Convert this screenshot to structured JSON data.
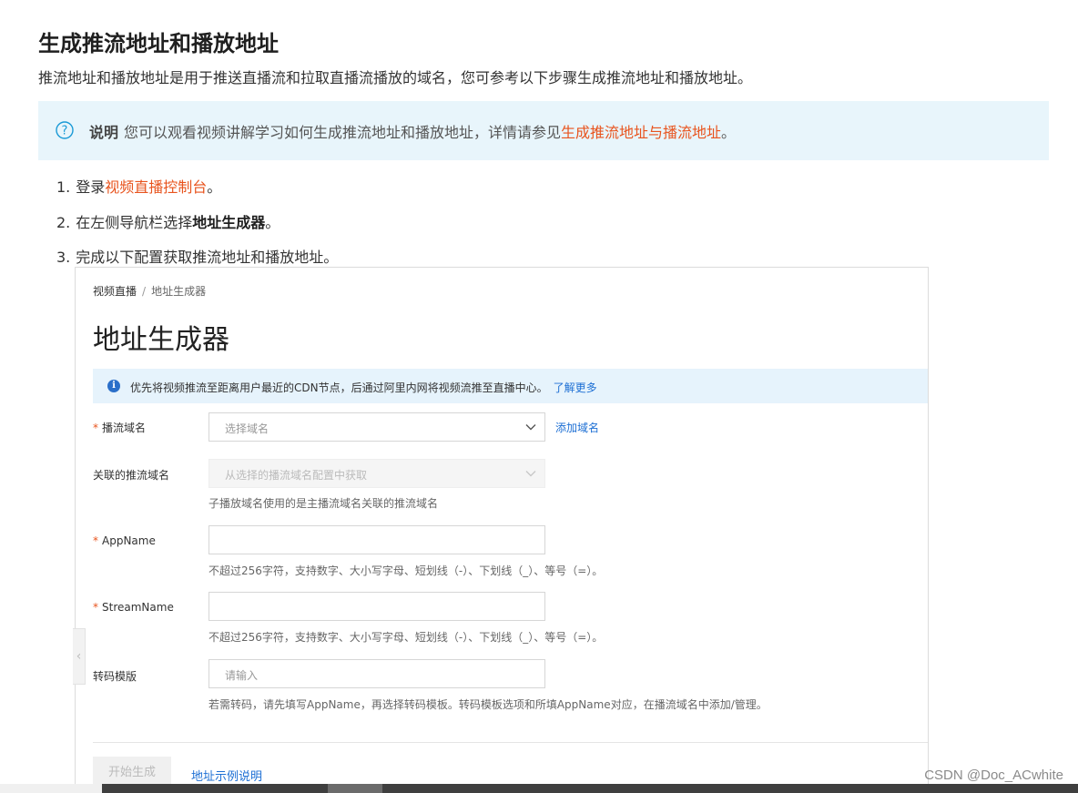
{
  "doc": {
    "title": "生成推流地址和播放地址",
    "intro": "推流地址和播放地址是用于推送直播流和拉取直播流播放的域名，您可参考以下步骤生成推流地址和播放地址。",
    "note": {
      "icon": "question-circle-icon",
      "label": "说明",
      "text": "您可以观看视频讲解学习如何生成推流地址和播放地址，详情请参见",
      "link": "生成推流地址与播流地址",
      "end": "。"
    },
    "steps": [
      {
        "num": "1.",
        "pre": "登录",
        "link": "视频直播控制台",
        "post": "。"
      },
      {
        "num": "2.",
        "pre": "在左侧导航栏选择",
        "bold": "地址生成器",
        "post": "。"
      },
      {
        "num": "3.",
        "pre": "完成以下配置获取推流地址和播放地址。"
      }
    ],
    "colors": {
      "link_orange": "#e8541e",
      "note_bg": "#e8f5fb",
      "console_link": "#1d6fd4"
    }
  },
  "console": {
    "breadcrumb": {
      "root": "视频直播",
      "sep": "/",
      "current": "地址生成器"
    },
    "title": "地址生成器",
    "info": {
      "text": "优先将视频推流至距离用户最近的CDN节点，后通过阿里内网将视频流推至直播中心。",
      "link": "了解更多"
    },
    "fields": {
      "play_domain": {
        "label": "播流域名",
        "required": "*",
        "placeholder": "选择域名",
        "add_link": "添加域名"
      },
      "push_domain": {
        "label": "关联的推流域名",
        "placeholder": "从选择的播流域名配置中获取",
        "help": "子播放域名使用的是主播流域名关联的推流域名"
      },
      "app_name": {
        "label": "AppName",
        "required": "*",
        "value": "",
        "help": "不超过256字符，支持数字、大小写字母、短划线（-）、下划线（_）、等号（=）。"
      },
      "stream_name": {
        "label": "StreamName",
        "required": "*",
        "value": "",
        "help": "不超过256字符，支持数字、大小写字母、短划线（-）、下划线（_）、等号（=）。"
      },
      "transcode": {
        "label": "转码模版",
        "placeholder": "请输入",
        "help": "若需转码，请先填写AppName，再选择转码模板。转码模板选项和所填AppName对应，在播流域名中添加/管理。"
      }
    },
    "buttons": {
      "start": "开始生成",
      "example": "地址示例说明"
    }
  },
  "watermark": "CSDN @Doc_ACwhite"
}
